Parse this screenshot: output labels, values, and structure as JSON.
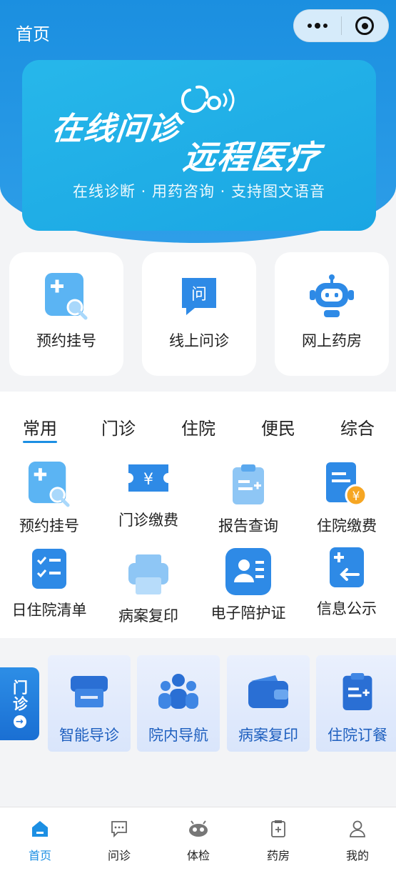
{
  "header": {
    "title": "首页"
  },
  "capsule": {
    "more_icon": "more-dots-icon",
    "close_icon": "target-icon"
  },
  "banner": {
    "title1": "在线问诊",
    "title2": "远程医疗",
    "subtitle": "在线诊断 · 用药咨询 · 支持图文语音"
  },
  "quick": [
    {
      "label": "预约挂号",
      "icon": "appointment-icon"
    },
    {
      "label": "线上问诊",
      "icon": "chat-question-icon"
    },
    {
      "label": "网上药房",
      "icon": "robot-icon"
    }
  ],
  "tabs": [
    "常用",
    "门诊",
    "住院",
    "便民",
    "综合"
  ],
  "grid": [
    {
      "label": "预约挂号",
      "icon": "appointment-icon"
    },
    {
      "label": "门诊缴费",
      "icon": "ticket-yen-icon"
    },
    {
      "label": "报告查询",
      "icon": "clipboard-icon"
    },
    {
      "label": "住院缴费",
      "icon": "bill-yen-icon"
    },
    {
      "label": "日住院清单",
      "icon": "checklist-icon"
    },
    {
      "label": "病案复印",
      "icon": "printer-icon"
    },
    {
      "label": "电子陪护证",
      "icon": "id-card-icon"
    },
    {
      "label": "信息公示",
      "icon": "notice-icon"
    }
  ],
  "services": {
    "side_label": "门诊",
    "items": [
      {
        "label": "智能导诊",
        "icon": "printer-icon"
      },
      {
        "label": "院内导航",
        "icon": "people-icon"
      },
      {
        "label": "病案复印",
        "icon": "wallet-icon"
      },
      {
        "label": "住院订餐",
        "icon": "clipboard-icon"
      }
    ]
  },
  "nav": [
    {
      "label": "首页",
      "icon": "home-icon",
      "active": true
    },
    {
      "label": "问诊",
      "icon": "chat-icon"
    },
    {
      "label": "体检",
      "icon": "checkup-icon"
    },
    {
      "label": "药房",
      "icon": "pharmacy-icon"
    },
    {
      "label": "我的",
      "icon": "user-icon"
    }
  ],
  "colors": {
    "primary": "#1c8fe3",
    "banner": "#1ea9e5"
  }
}
